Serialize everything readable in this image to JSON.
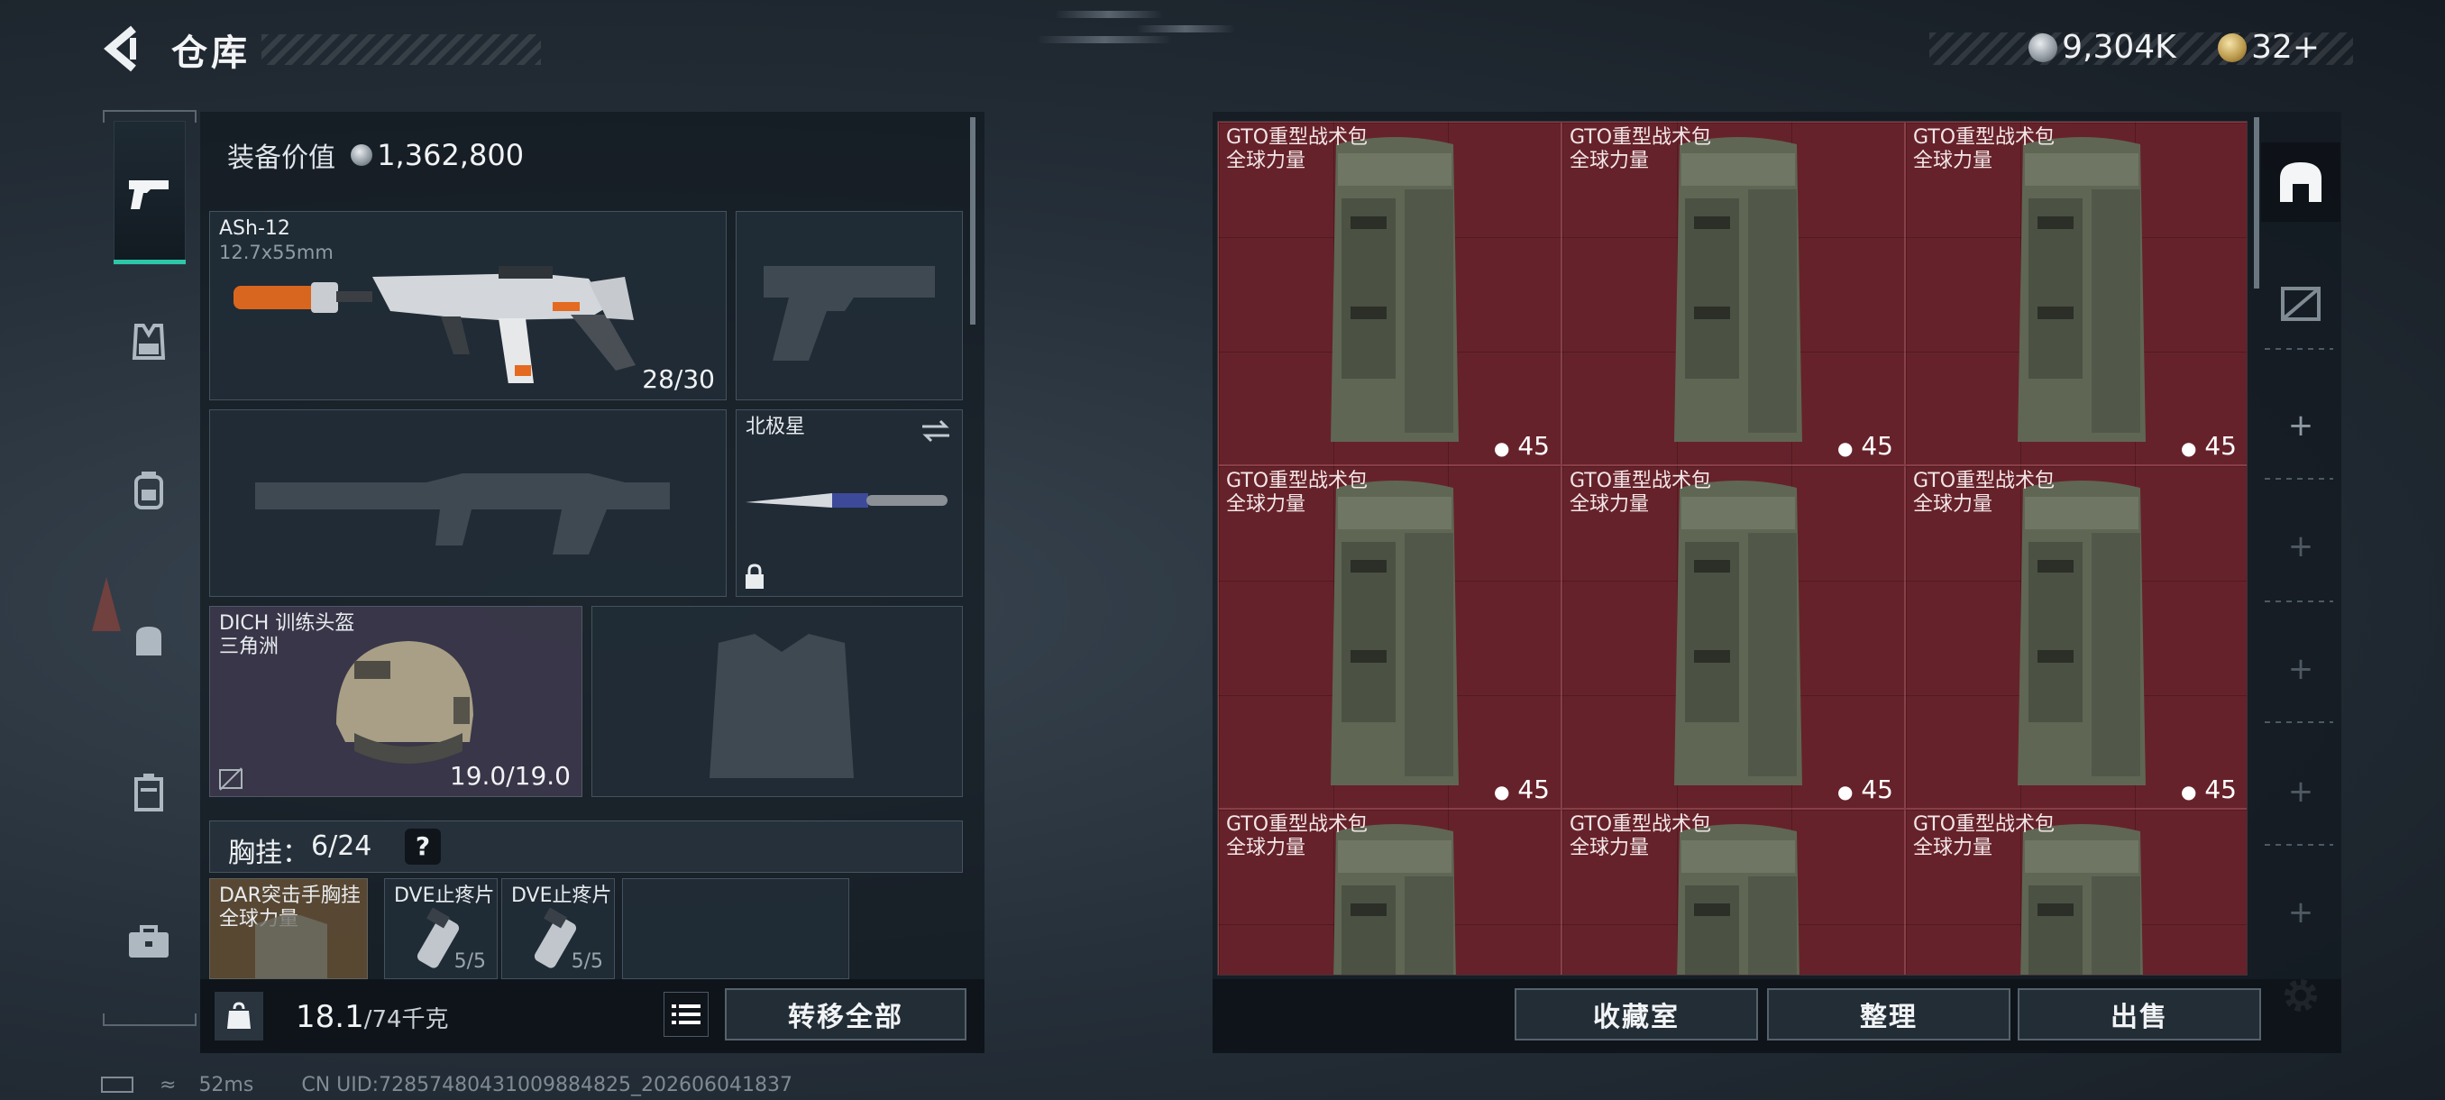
{
  "header": {
    "title": "仓库",
    "currency_silver": "9,304K",
    "currency_gold": "32",
    "currency_gold_plus": "+"
  },
  "left_rail": {
    "items": [
      "pistol-icon",
      "vest-icon",
      "backpack-icon",
      "pouch-icon",
      "container-icon",
      "toolbox-icon"
    ]
  },
  "equipment": {
    "value_label": "装备价值",
    "value": "1,362,800",
    "primary": {
      "name": "ASh-12",
      "ammo_type": "12.7x55mm",
      "ammo": "28/30"
    },
    "melee": {
      "name": "北极星"
    },
    "helmet": {
      "name": "DICH 训练头盔",
      "source": "三角洲",
      "durability": "19.0/19.0"
    },
    "chest_rig": {
      "label": "胸挂：",
      "count": "6/24",
      "help": "?"
    },
    "rig_items": [
      {
        "name": "DAR突击手胸挂",
        "source": "全球力量"
      },
      {
        "name": "DVE止疼片",
        "uses": "5/5"
      },
      {
        "name": "DVE止疼片",
        "uses": "5/5"
      }
    ],
    "weight": "18.1",
    "weight_max": "/74千克",
    "transfer_all": "转移全部"
  },
  "stash": {
    "items": [
      {
        "name": "GTO重型战术包",
        "source": "全球力量",
        "count": "45"
      },
      {
        "name": "GTO重型战术包",
        "source": "全球力量",
        "count": "45"
      },
      {
        "name": "GTO重型战术包",
        "source": "全球力量",
        "count": "45"
      },
      {
        "name": "GTO重型战术包",
        "source": "全球力量",
        "count": "45"
      },
      {
        "name": "GTO重型战术包",
        "source": "全球力量",
        "count": "45"
      },
      {
        "name": "GTO重型战术包",
        "source": "全球力量",
        "count": "45"
      },
      {
        "name": "GTO重型战术包",
        "source": "全球力量",
        "count": ""
      },
      {
        "name": "GTO重型战术包",
        "source": "全球力量",
        "count": ""
      },
      {
        "name": "GTO重型战术包",
        "source": "全球力量",
        "count": ""
      }
    ],
    "buttons": {
      "collection": "收藏室",
      "sort": "整理",
      "sell": "出售"
    }
  },
  "status_bar": {
    "ping": "52ms",
    "uid": "CN UID:72857480431009884825_202606041837"
  },
  "colors": {
    "accent": "#2ec6a8",
    "item_bg": "#66222a",
    "panel": "#1a232c"
  }
}
